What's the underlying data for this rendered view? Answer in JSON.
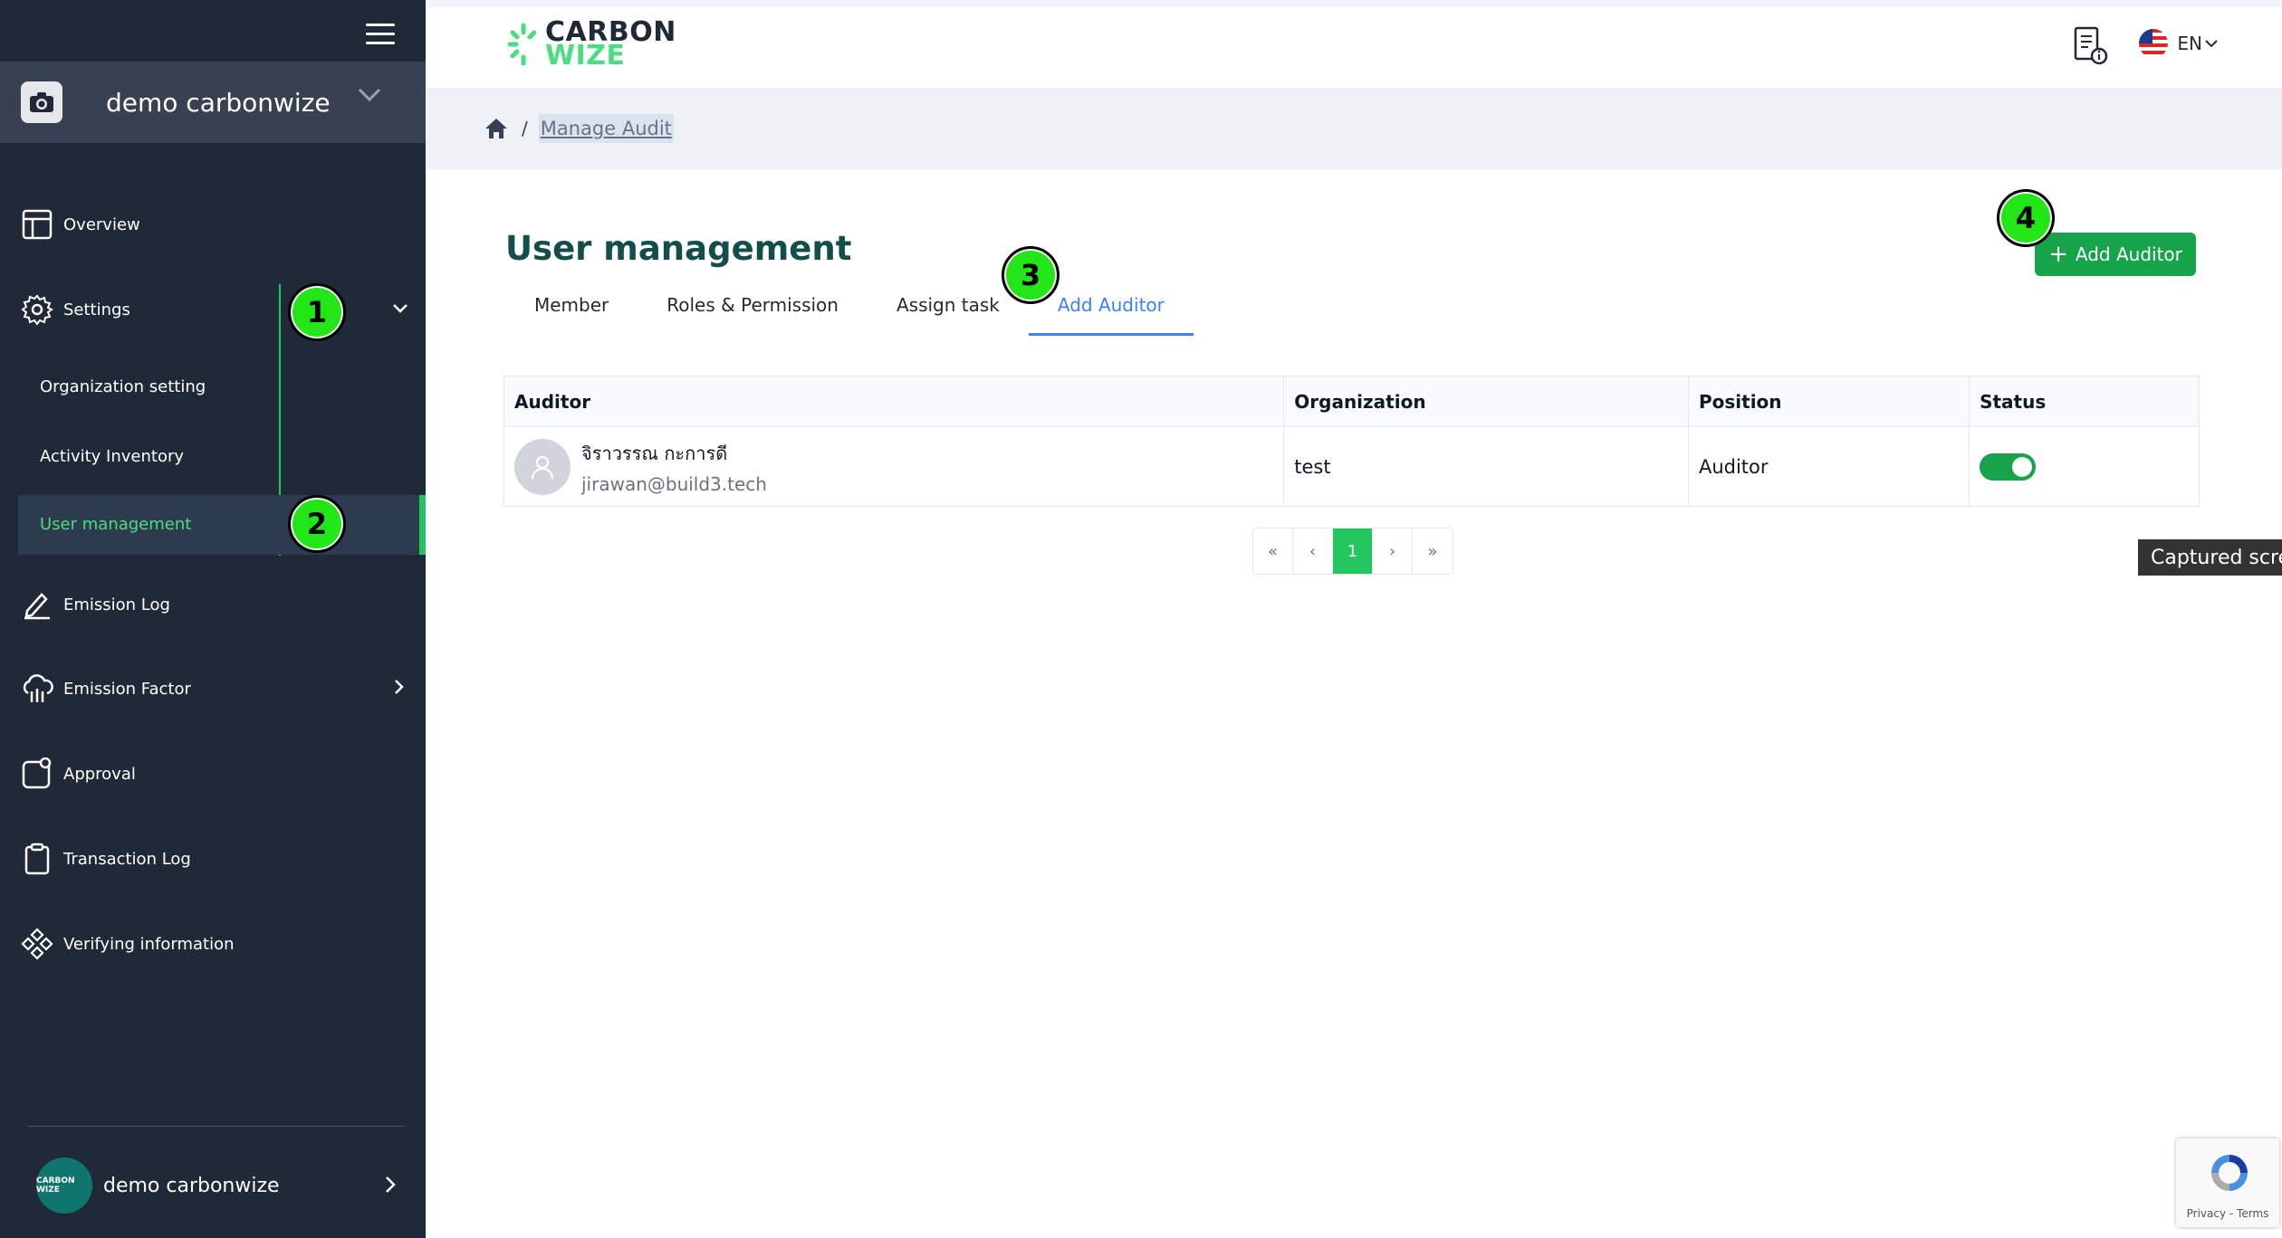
{
  "sidebar": {
    "org_name": "demo carbonwize",
    "nav": {
      "overview": "Overview",
      "settings": "Settings",
      "settings_sub": {
        "org_setting": "Organization setting",
        "activity_inventory": "Activity Inventory",
        "user_management": "User management"
      },
      "emission_log": "Emission Log",
      "emission_factor": "Emission Factor",
      "approval": "Approval",
      "transaction_log": "Transaction Log",
      "verifying": "Verifying information"
    },
    "user": {
      "name": "demo carbonwize",
      "avatar_text": "CARBON WIZE"
    }
  },
  "header": {
    "logo_line1": "CARBON",
    "logo_line2": "WIZE",
    "language": "EN"
  },
  "breadcrumb": {
    "current": "Manage Audit"
  },
  "main": {
    "title": "User management",
    "add_button": "Add Auditor",
    "tabs": [
      "Member",
      "Roles & Permission",
      "Assign task",
      "Add Auditor"
    ],
    "active_tab": "Add Auditor",
    "table": {
      "headers": [
        "Auditor",
        "Organization",
        "Position",
        "Status"
      ],
      "rows": [
        {
          "name": "จิราวรรณ กะการดี",
          "email": "jirawan@build3.tech",
          "organization": "test",
          "position": "Auditor",
          "status_on": true
        }
      ]
    },
    "pagination": {
      "first": "«",
      "prev": "‹",
      "current": "1",
      "next": "›",
      "last": "»"
    }
  },
  "tooltip": "Captured scre",
  "recaptcha": {
    "text": "Privacy - Terms"
  },
  "markers": [
    "1",
    "2",
    "3",
    "4"
  ],
  "colors": {
    "sidebar_bg": "#1f2937",
    "accent_green": "#16a34a",
    "active_tab": "#3b82f6",
    "title": "#134e4a"
  }
}
